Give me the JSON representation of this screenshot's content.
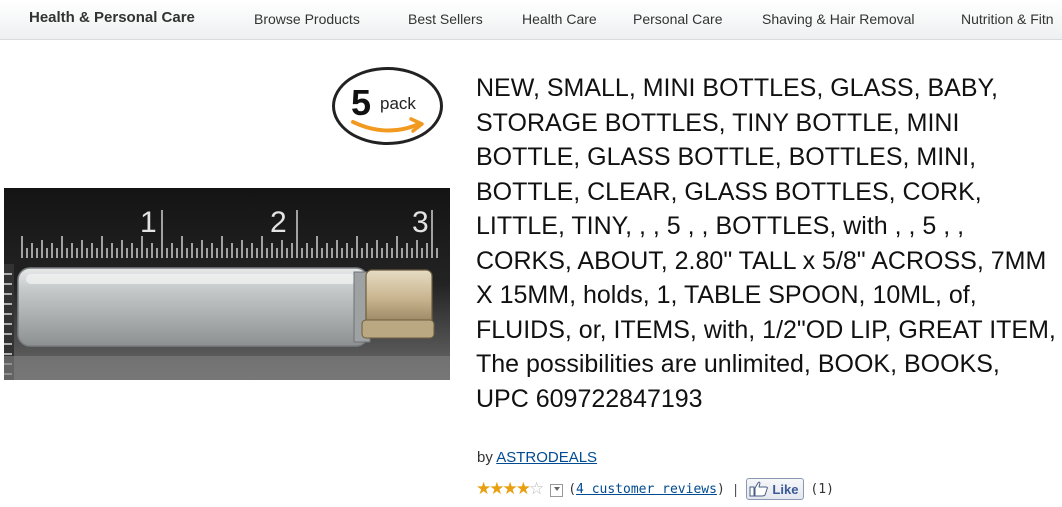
{
  "topnav": {
    "category": "Health & Personal Care",
    "items": [
      "Browse Products",
      "Best Sellers",
      "Health Care",
      "Personal Care",
      "Shaving & Hair Removal",
      "Nutrition & Fitn"
    ]
  },
  "badge": {
    "count": "5",
    "unit": "pack"
  },
  "image": {
    "ruler_numbers": [
      "1",
      "2",
      "3"
    ]
  },
  "product": {
    "title": "NEW, SMALL, MINI BOTTLES, GLASS, BABY, STORAGE BOTTLES, TINY BOTTLE, MINI BOTTLE, GLASS BOTTLE, BOTTLES, MINI, BOTTLE, CLEAR, GLASS BOTTLES, CORK, LITTLE, TINY, , , 5 , , BOTTLES, with , , 5 , , CORKS, ABOUT, 2.80\" TALL x 5/8\" ACROSS, 7MM X 15MM, holds, 1, TABLE SPOON, 10ML, of, FLUIDS, or, ITEMS, with, 1/2\"OD LIP, GREAT ITEM, The possibilities are unlimited, BOOK, BOOKS, UPC 609722847193",
    "by_label": "by",
    "seller": "ASTRODEALS"
  },
  "rating": {
    "stars": 4,
    "max": 5,
    "reviews_text": "4 customer reviews",
    "open_paren": "(",
    "close_paren": ")",
    "separator": "|"
  },
  "like": {
    "label": "Like",
    "count": "(1)"
  },
  "colors": {
    "link": "#004b91",
    "star": "#e8a010",
    "facebook": "#3b5998"
  }
}
